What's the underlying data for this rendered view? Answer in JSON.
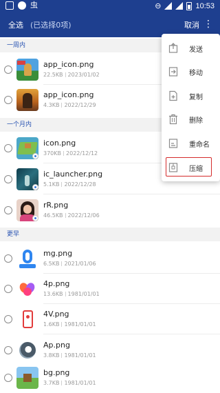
{
  "status_bar": {
    "left_glyph": "虫",
    "clock": "10:53"
  },
  "app_bar": {
    "select_all": "全选",
    "selected_count": "(已选择0项)",
    "cancel": "取消",
    "more_glyph": "⋮"
  },
  "sections": [
    {
      "header": "一周内",
      "files": [
        {
          "name": "app_icon.png",
          "size": "22.5KB",
          "date": "2023/01/02",
          "thumb": "game-character-icon"
        },
        {
          "name": "app_icon.png",
          "size": "4.3KB",
          "date": "2022/12/29",
          "thumb": "game-warrior-icon"
        }
      ]
    },
    {
      "header": "一个月内",
      "files": [
        {
          "name": "icon.png",
          "size": "370KB",
          "date": "2022/12/12",
          "thumb": "island-game-icon"
        },
        {
          "name": "ic_launcher.png",
          "size": "5.1KB",
          "date": "2022/12/28",
          "thumb": "dark-game-icon"
        },
        {
          "name": "rR.png",
          "size": "46.5KB",
          "date": "2022/12/06",
          "thumb": "girl-avatar-icon"
        }
      ]
    },
    {
      "header": "更早",
      "files": [
        {
          "name": "mg.png",
          "size": "6.5KB",
          "date": "2021/01/06",
          "thumb": "blue-o-app-icon"
        },
        {
          "name": "4p.png",
          "size": "13.6KB",
          "date": "1981/01/01",
          "thumb": "colorful-petal-icon"
        },
        {
          "name": "4V.png",
          "size": "1.6KB",
          "date": "1981/01/01",
          "thumb": "red-phone-icon"
        },
        {
          "name": "Ap.png",
          "size": "3.8KB",
          "date": "1981/01/01",
          "thumb": "grey-sphere-icon"
        },
        {
          "name": "bg.png",
          "size": "3.7KB",
          "date": "1981/01/01",
          "thumb": "blocky-landscape-icon"
        }
      ]
    }
  ],
  "menu": {
    "items": [
      {
        "label": "发送",
        "icon": "send-icon"
      },
      {
        "label": "移动",
        "icon": "move-icon"
      },
      {
        "label": "复制",
        "icon": "copy-icon"
      },
      {
        "label": "删除",
        "icon": "trash-icon"
      },
      {
        "label": "重命名",
        "icon": "rename-icon"
      },
      {
        "label": "压缩",
        "icon": "compress-icon"
      }
    ],
    "highlighted_index": 5
  },
  "colors": {
    "header_blue": "#1e3f8f",
    "section_text_blue": "#2b55b3",
    "highlight_red": "#d42a2a"
  }
}
